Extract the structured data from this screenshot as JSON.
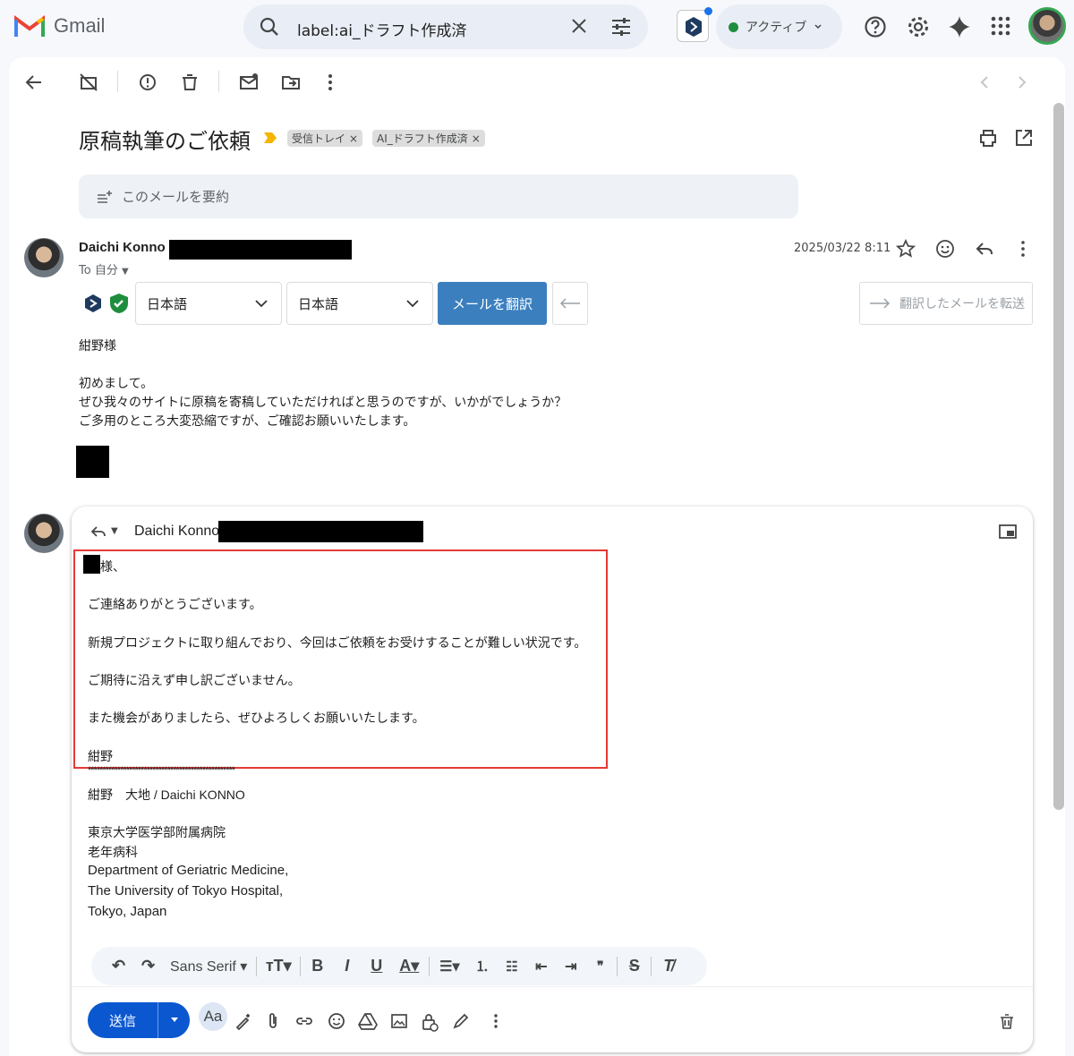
{
  "topbar": {
    "app_name": "Gmail",
    "search_query": "label:ai_ドラフト作成済",
    "status": "アクティブ"
  },
  "message": {
    "subject": "原稿執筆のご依頼",
    "labels": [
      "受信トレイ",
      "AI_ドラフト作成済"
    ],
    "summary_label": "このメールを要約",
    "sender_name": "Daichi Konno",
    "to_label": "To 自分",
    "date": "2025/03/22 8:11",
    "body": [
      "紺野様",
      "",
      "初めまして。",
      "ぜひ我々のサイトに原稿を寄稿していただければと思うのですが、いかがでしょうか？",
      "ご多用のところ大変恐縮ですが、ご確認お願いいたします。"
    ]
  },
  "translate": {
    "source_lang": "日本語",
    "target_lang": "日本語",
    "translate_button": "メールを翻訳",
    "forward_button": "翻訳したメールを転送"
  },
  "reply": {
    "to_name": "Daichi Konno",
    "draft_lines": [
      "様、",
      "ご連絡ありがとうございます。",
      "新規プロジェクトに取り組んでおり、今回はご依頼をお受けすることが難しい状況です。",
      "ご期待に沿えず申し訳ございません。",
      "また機会がありましたら、ぜひよろしくお願いいたします。",
      "紺野"
    ],
    "signature_rule": "**************************************************",
    "signature": [
      "紺野　大地 / Daichi KONNO",
      "東京大学医学部附属病院",
      "老年病科",
      "Department of Geriatric Medicine,",
      "The University of Tokyo Hospital,",
      "Tokyo, Japan"
    ],
    "font_name": "Sans Serif",
    "send_label": "送信"
  }
}
